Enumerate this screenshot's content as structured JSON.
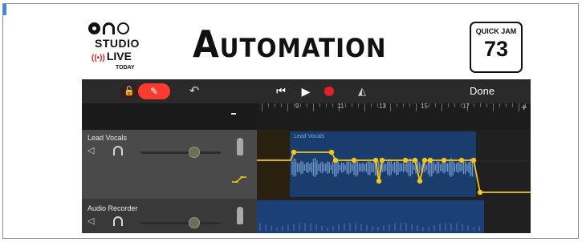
{
  "header": {
    "logo": {
      "line1": "STUDIO",
      "line2": "LIVE",
      "line3": "TODAY"
    },
    "title": "Automation",
    "badge": {
      "label": "QUICK JAM",
      "number": "73"
    }
  },
  "toolbar": {
    "done_label": "Done",
    "icons": [
      "lock-icon",
      "pencil-icon",
      "undo-icon",
      "rewind-icon",
      "play-icon",
      "record-icon",
      "metronome-icon"
    ]
  },
  "ruler": {
    "bars": [
      "9",
      "11",
      "13",
      "15",
      "17"
    ]
  },
  "tracks": [
    {
      "name": "Lead Vocals",
      "volume": 0.7,
      "region_label": "Lead Vocals"
    },
    {
      "name": "Audio Recorder",
      "volume": 0.7
    }
  ],
  "colors": {
    "record": "#e0202a",
    "pencil_active": "#ff3b30",
    "automation": "#f5c518",
    "region": "#1a3d6e"
  }
}
